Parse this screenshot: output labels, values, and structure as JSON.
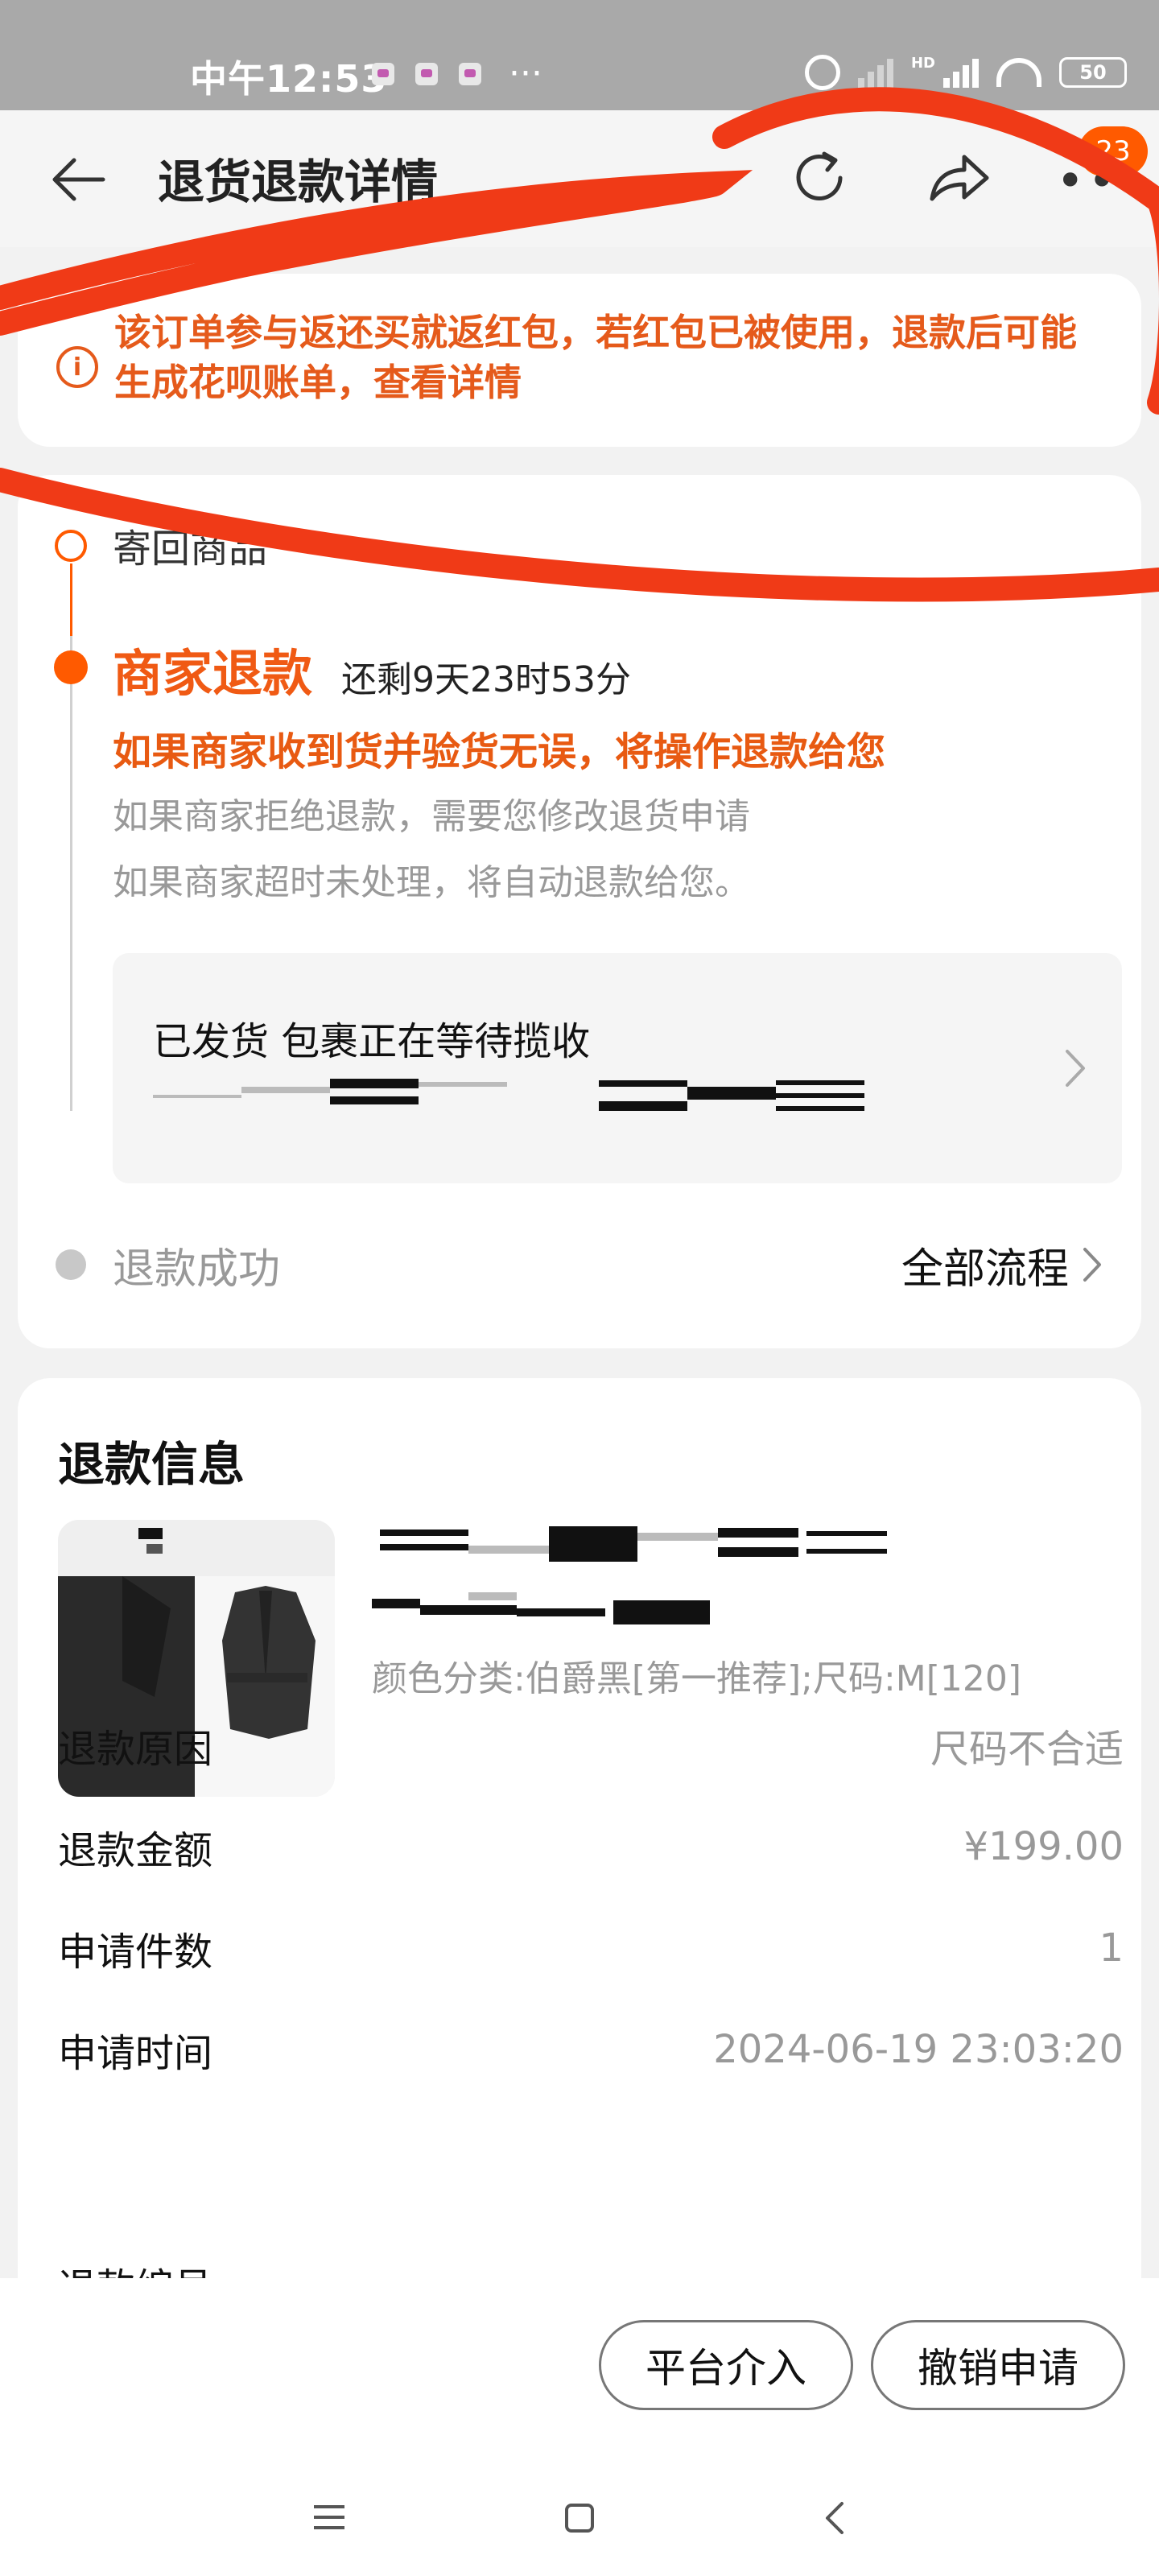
{
  "status_bar": {
    "time": "中午12:53",
    "hd_label": "HD",
    "battery": "50"
  },
  "header": {
    "title": "退货退款详情",
    "badge_count": "23",
    "icons": [
      "back-arrow-icon",
      "refresh-icon",
      "share-icon",
      "more-icon"
    ]
  },
  "notice": {
    "icon": "info-icon",
    "text": "该订单参与返还买就返红包，若红包已被使用，退款后可能生成花呗账单，查看详情"
  },
  "timeline": {
    "step_1": "寄回商品",
    "step_2": "商家退款",
    "countdown": "还剩9天23时53分",
    "desc_highlight": "如果商家收到货并验货无误，将操作退款给您",
    "desc_reject": "如果商家拒绝退款，需要您修改退货申请",
    "desc_timeout": "如果商家超时未处理，将自动退款给您。",
    "shipping_status": "已发货  包裹正在等待揽收",
    "step_3": "退款成功",
    "all_process": "全部流程"
  },
  "refund_info": {
    "title": "退款信息",
    "sku": "颜色分类:伯爵黑[第一推荐];尺码:M[120]",
    "rows": [
      {
        "label": "退款原因",
        "value": "尺码不合适"
      },
      {
        "label": "退款金额",
        "value": "¥199.00"
      },
      {
        "label": "申请件数",
        "value": "1"
      },
      {
        "label": "申请时间",
        "value": "2024-06-19 23:03:20"
      }
    ],
    "next_row_label": "退款编号"
  },
  "actions": {
    "platform_button": "平台介入",
    "cancel_button": "撤销申请"
  },
  "colors": {
    "accent": "#ff5a00",
    "notice_text": "#e55a1b",
    "scribble": "#f03a17"
  }
}
